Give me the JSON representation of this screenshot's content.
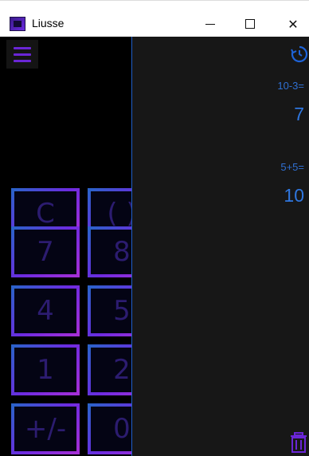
{
  "window": {
    "title": "Liusse",
    "minimize": "—",
    "maximize": "☐",
    "close": "✕"
  },
  "keypad": [
    {
      "label": "C"
    },
    {
      "label": "( )"
    },
    {
      "label": "7"
    },
    {
      "label": "8"
    },
    {
      "label": "4"
    },
    {
      "label": "5"
    },
    {
      "label": "1"
    },
    {
      "label": "2"
    },
    {
      "label": "+/-"
    },
    {
      "label": "0"
    }
  ],
  "history": {
    "entries": [
      {
        "expression": "10-3=",
        "result": "7"
      },
      {
        "expression": "5+5=",
        "result": "10"
      }
    ]
  },
  "colors": {
    "accent_blue": "#1e63d8",
    "accent_purple": "#6a26d6",
    "history_bg": "#171717"
  }
}
